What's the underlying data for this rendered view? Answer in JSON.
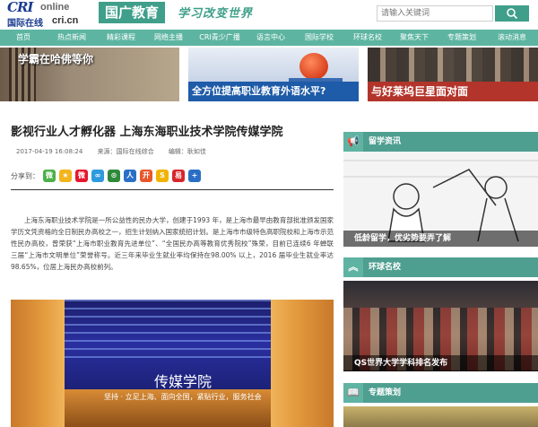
{
  "header": {
    "logo_cri": "CRI",
    "logo_online": "online",
    "logo_cn_name": "国际在线",
    "logo_domain": "cri.cn",
    "channel_tag": "国广教育",
    "slogan": "学习改变世界",
    "search_placeholder": "请输入关键词"
  },
  "nav": {
    "items": [
      "首页",
      "热点新闻",
      "精彩课程",
      "网络主播",
      "CRI青少广播",
      "语言中心",
      "国际学校",
      "环球名校",
      "聚焦天下",
      "专题策划",
      "滚动消息"
    ]
  },
  "banners": [
    {
      "caption": "学霸在哈佛等你"
    },
    {
      "caption": "全方位提高职业教育外语水平?"
    },
    {
      "caption": "与好莱坞巨星面对面"
    }
  ],
  "article": {
    "title": "影视行业人才孵化器  上海东海职业技术学院传媒学院",
    "date": "2017-04-19 16:08:24",
    "source": "来源：国际在线综合",
    "editor": "编辑：耿如佳",
    "share_label": "分享到：",
    "share_icons": [
      {
        "name": "wechat-icon",
        "color": "#4cb14a",
        "glyph": "微"
      },
      {
        "name": "qzone-icon",
        "color": "#f2b51c",
        "glyph": "★"
      },
      {
        "name": "weibo-icon",
        "color": "#e6162d",
        "glyph": "微"
      },
      {
        "name": "tencent-weibo-icon",
        "color": "#2f9ade",
        "glyph": "∞"
      },
      {
        "name": "douban-icon",
        "color": "#2e8a3a",
        "glyph": "⊙"
      },
      {
        "name": "renren-icon",
        "color": "#2a6fc6",
        "glyph": "人"
      },
      {
        "name": "kaixin-icon",
        "color": "#e8562a",
        "glyph": "开"
      },
      {
        "name": "sohu-icon",
        "color": "#f0b400",
        "glyph": "S"
      },
      {
        "name": "netease-icon",
        "color": "#d6262c",
        "glyph": "易"
      },
      {
        "name": "more-icon",
        "color": "#2a6fc6",
        "glyph": "+"
      }
    ],
    "paragraph": "上海东海职业技术学院是一所公益性的民办大学，创建于1993 年，是上海市最早由教育部批准颁发国家学历文凭资格的全日制民办高校之一，招生计划纳入国家统招计划。是上海市市级特色高职院校和上海市示范性民办高校，曾荣获“上海市职业教育先进单位”、“全国民办高等教育优秀院校”殊荣，目前已连续6 年蝉联三届“上海市文明单位”荣誉称号。近三年来毕业生就业率均保持在98.00% 以上，2016 届毕业生就业率达98.65%，位居上海民办高校前列。",
    "photo_title": "传媒学院",
    "photo_subtitle": "坚持 · 立足上海、面向全国，紧贴行业，服务社会"
  },
  "sidebar": {
    "sections": [
      {
        "title": "留学资讯",
        "icon": "megaphone-icon",
        "caption": "低龄留学，优劣势要弄了解"
      },
      {
        "title": "环球名校",
        "icon": "chevron-up-icon",
        "caption": "QS世界大学学科排名发布"
      },
      {
        "title": "专题策划",
        "icon": "book-icon",
        "caption": ""
      }
    ]
  },
  "colors": {
    "accent": "#4f9f91",
    "nav_bg": "#5db5a1",
    "channel_tag": "#3f9f8a"
  }
}
